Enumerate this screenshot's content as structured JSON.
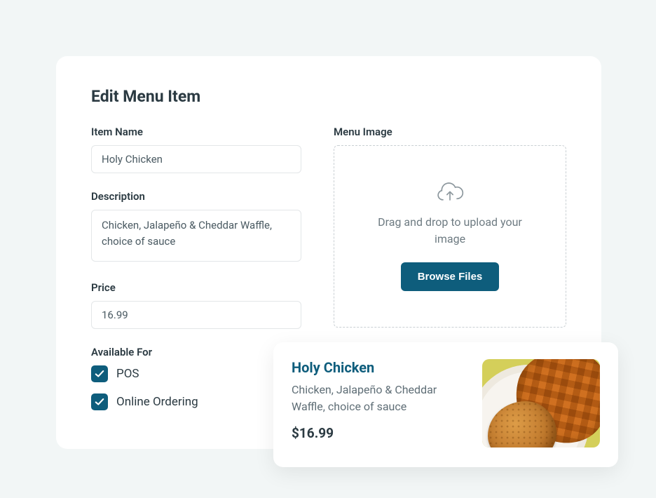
{
  "page": {
    "title": "Edit Menu Item"
  },
  "fields": {
    "item_name_label": "Item Name",
    "item_name_value": "Holy Chicken",
    "description_label": "Description",
    "description_value": "Chicken, Jalapeño & Cheddar Waffle, choice of sauce",
    "price_label": "Price",
    "price_value": "16.99",
    "available_for_label": "Available For",
    "available_for_options": [
      {
        "label": "POS",
        "checked": true
      },
      {
        "label": "Online Ordering",
        "checked": true
      }
    ]
  },
  "menu_image": {
    "label": "Menu Image",
    "drop_text": "Drag and drop to upload your image",
    "browse_button": "Browse Files"
  },
  "preview": {
    "title": "Holy Chicken",
    "description": "Chicken, Jalapeño & Cheddar Waffle, choice of sauce",
    "price": "$16.99"
  }
}
